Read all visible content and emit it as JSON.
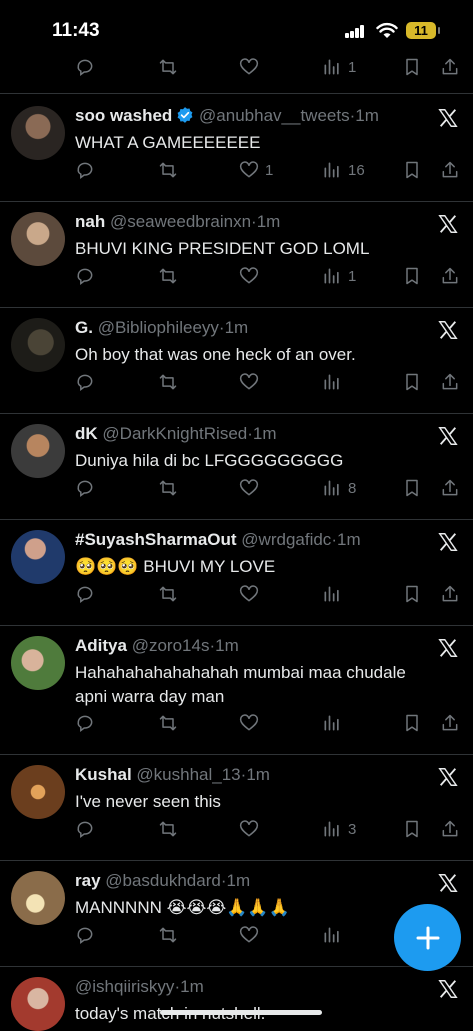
{
  "status_bar": {
    "time": "11:43",
    "battery": "11"
  },
  "top_actions": {
    "views": "1"
  },
  "tweets": [
    {
      "name": "soo washed",
      "handle": "@anubhav__tweets",
      "time": "1m",
      "verified": true,
      "text": "WHAT A GAMEEEEEEE",
      "likes": "1",
      "views": "16"
    },
    {
      "name": "nah",
      "handle": "@seaweedbrainxn",
      "time": "1m",
      "text": "BHUVI KING PRESIDENT GOD LOML",
      "likes": "",
      "views": "1"
    },
    {
      "name": "G.",
      "handle": "@Bibliophileeyy",
      "time": "1m",
      "text": "Oh boy that was one heck of an over.",
      "likes": "",
      "views": ""
    },
    {
      "name": "dK",
      "handle": "@DarkKnightRised",
      "time": "1m",
      "text": "Duniya hila di bc LFGGGGGGGGG",
      "likes": "",
      "views": "8"
    },
    {
      "name": "#SuyashSharmaOut",
      "handle": "@wrdgafidc",
      "time": "1m",
      "text_emoji": "🥺🥺🥺",
      "text": "BHUVI MY LOVE",
      "likes": "",
      "views": ""
    },
    {
      "name": "Aditya",
      "handle": "@zoro14s",
      "time": "1m",
      "text": "Hahahahahahahahah mumbai maa chudale apni warra day man",
      "likes": "",
      "views": ""
    },
    {
      "name": "Kushal",
      "handle": "@kushhal_13",
      "time": "1m",
      "text": "I've never seen this",
      "likes": "",
      "views": "3"
    },
    {
      "name": "ray",
      "handle": "@basdukhdard",
      "time": "1m",
      "text": "MANNNNN",
      "text_emoji": "😭😭😭🙏🙏🙏",
      "likes": "",
      "views": ""
    },
    {
      "name": "",
      "handle": "@ishqiiriskyy",
      "time": "1m",
      "text": "today's match in nutshell."
    }
  ],
  "separator": "·",
  "colors": {
    "accent": "#1d9bf0",
    "muted": "#71767b",
    "text": "#e7e9ea",
    "divider": "#2f3336"
  }
}
